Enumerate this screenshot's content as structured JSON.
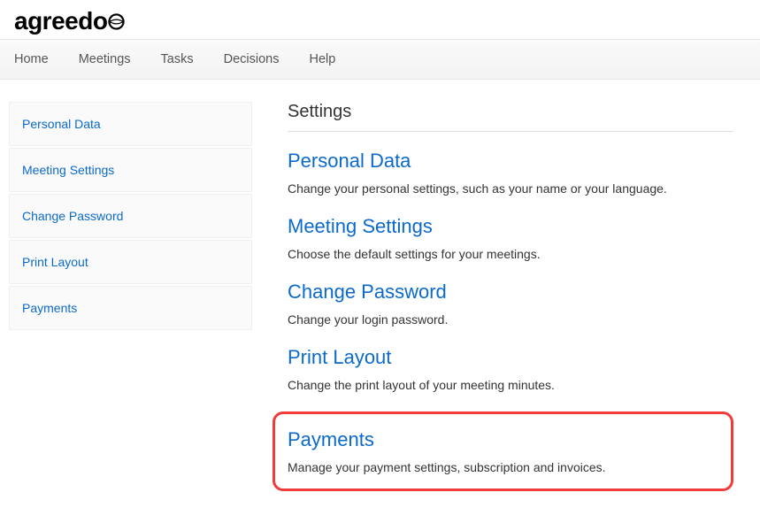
{
  "brand": {
    "name": "agreedo"
  },
  "nav": {
    "home": "Home",
    "meetings": "Meetings",
    "tasks": "Tasks",
    "decisions": "Decisions",
    "help": "Help"
  },
  "sidebar": {
    "items": [
      {
        "label": "Personal Data"
      },
      {
        "label": "Meeting Settings"
      },
      {
        "label": "Change Password"
      },
      {
        "label": "Print Layout"
      },
      {
        "label": "Payments"
      }
    ]
  },
  "main": {
    "title": "Settings",
    "sections": [
      {
        "title": "Personal Data",
        "desc": "Change your personal settings, such as your name or your language."
      },
      {
        "title": "Meeting Settings",
        "desc": "Choose the default settings for your meetings."
      },
      {
        "title": "Change Password",
        "desc": "Change your login password."
      },
      {
        "title": "Print Layout",
        "desc": "Change the print layout of your meeting minutes."
      },
      {
        "title": "Payments",
        "desc": "Manage your payment settings, subscription and invoices."
      }
    ]
  }
}
